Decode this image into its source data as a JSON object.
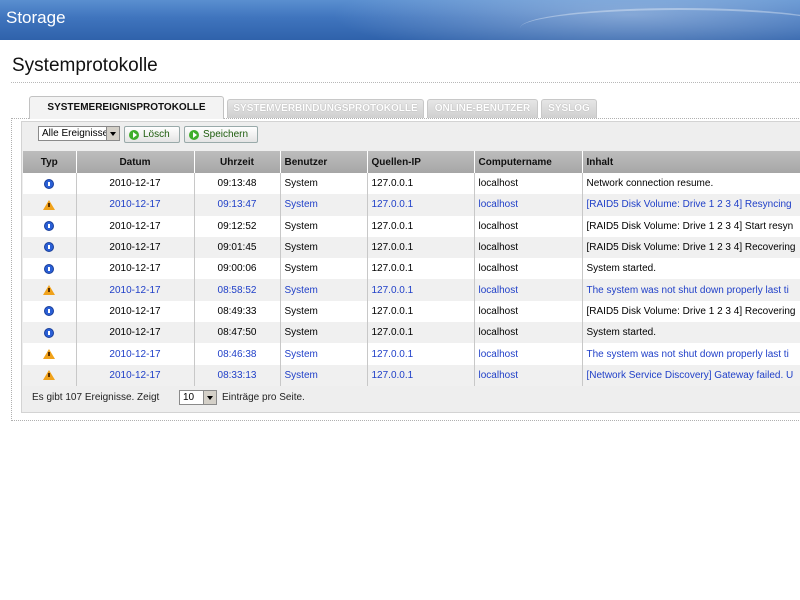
{
  "header": {
    "app_title": "Storage"
  },
  "page": {
    "title": "Systemprotokolle"
  },
  "tabs": [
    {
      "label": "SYSTEMEREIGNISPROTOKOLLE",
      "active": true
    },
    {
      "label": "SYSTEMVERBINDUNGSPROTOKOLLE",
      "active": false
    },
    {
      "label": "ONLINE-BENUTZER",
      "active": false
    },
    {
      "label": "SYSLOG",
      "active": false
    }
  ],
  "toolbar": {
    "filter_value": "Alle Ereignisse",
    "delete_label": "Lösch",
    "save_label": "Speichern"
  },
  "table": {
    "columns": [
      "Typ",
      "Datum",
      "Uhrzeit",
      "Benutzer",
      "Quellen-IP",
      "Computername",
      "Inhalt"
    ],
    "rows": [
      {
        "type": "info-icon",
        "date": "2010-12-17",
        "time": "09:13:48",
        "user": "System",
        "ip": "127.0.0.1",
        "computer": "localhost",
        "content": "Network connection resume."
      },
      {
        "type": "warning-icon",
        "date": "2010-12-17",
        "time": "09:13:47",
        "user": "System",
        "ip": "127.0.0.1",
        "computer": "localhost",
        "content": "[RAID5 Disk Volume: Drive 1 2 3 4] Resyncing"
      },
      {
        "type": "info-icon",
        "date": "2010-12-17",
        "time": "09:12:52",
        "user": "System",
        "ip": "127.0.0.1",
        "computer": "localhost",
        "content": "[RAID5 Disk Volume: Drive 1 2 3 4] Start resyn"
      },
      {
        "type": "info-icon",
        "date": "2010-12-17",
        "time": "09:01:45",
        "user": "System",
        "ip": "127.0.0.1",
        "computer": "localhost",
        "content": "[RAID5 Disk Volume: Drive 1 2 3 4] Recovering"
      },
      {
        "type": "info-icon",
        "date": "2010-12-17",
        "time": "09:00:06",
        "user": "System",
        "ip": "127.0.0.1",
        "computer": "localhost",
        "content": "System started."
      },
      {
        "type": "warning-icon",
        "date": "2010-12-17",
        "time": "08:58:52",
        "user": "System",
        "ip": "127.0.0.1",
        "computer": "localhost",
        "content": "The system was not shut down properly last ti"
      },
      {
        "type": "info-icon",
        "date": "2010-12-17",
        "time": "08:49:33",
        "user": "System",
        "ip": "127.0.0.1",
        "computer": "localhost",
        "content": "[RAID5 Disk Volume: Drive 1 2 3 4] Recovering"
      },
      {
        "type": "info-icon",
        "date": "2010-12-17",
        "time": "08:47:50",
        "user": "System",
        "ip": "127.0.0.1",
        "computer": "localhost",
        "content": "System started."
      },
      {
        "type": "warning-icon",
        "date": "2010-12-17",
        "time": "08:46:38",
        "user": "System",
        "ip": "127.0.0.1",
        "computer": "localhost",
        "content": "The system was not shut down properly last ti"
      },
      {
        "type": "warning-icon",
        "date": "2010-12-17",
        "time": "08:33:13",
        "user": "System",
        "ip": "127.0.0.1",
        "computer": "localhost",
        "content": "[Network Service Discovery] Gateway failed. U"
      }
    ]
  },
  "footer": {
    "prefix": "Es gibt 107 Ereignisse. Zeigt",
    "per_page": "10",
    "suffix": "Einträge pro Seite."
  },
  "colors": {
    "header_blue": "#3f74bd",
    "warning_text": "#1f3fc8",
    "info_icon": "#2a5fd6",
    "warning_icon": "#f0a21b"
  }
}
